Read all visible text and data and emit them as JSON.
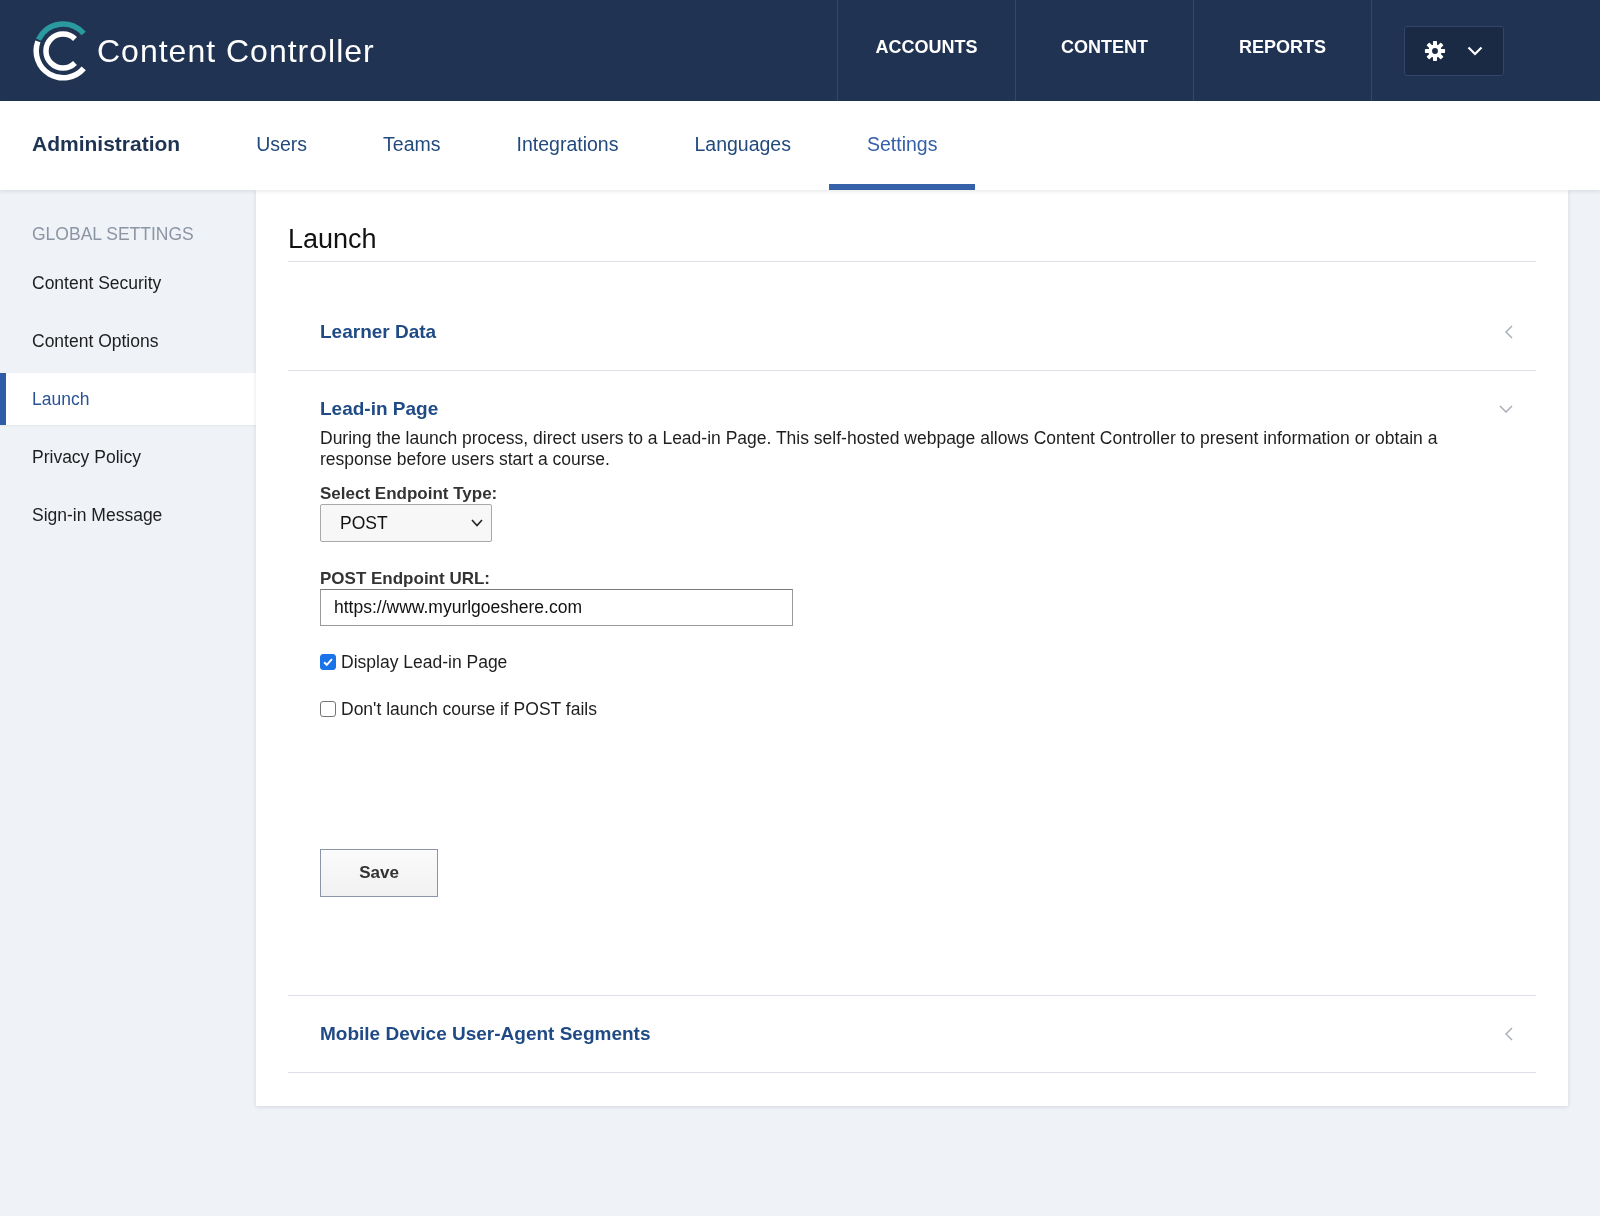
{
  "header": {
    "logo_text": "Content Controller",
    "nav": [
      {
        "label": "ACCOUNTS"
      },
      {
        "label": "CONTENT"
      },
      {
        "label": "REPORTS"
      }
    ]
  },
  "subnav": {
    "title": "Administration",
    "tabs": [
      {
        "label": "Users",
        "selected": false
      },
      {
        "label": "Teams",
        "selected": false
      },
      {
        "label": "Integrations",
        "selected": false
      },
      {
        "label": "Languages",
        "selected": false
      },
      {
        "label": "Settings",
        "selected": true
      }
    ]
  },
  "sidebar": {
    "heading": "GLOBAL SETTINGS",
    "items": [
      {
        "label": "Content Security",
        "selected": false
      },
      {
        "label": "Content Options",
        "selected": false
      },
      {
        "label": "Launch",
        "selected": true
      },
      {
        "label": "Privacy Policy",
        "selected": false
      },
      {
        "label": "Sign-in Message",
        "selected": false
      }
    ]
  },
  "page": {
    "title": "Launch",
    "sections": [
      {
        "title": "Learner Data",
        "expanded": false
      },
      {
        "title": "Lead-in Page",
        "expanded": true,
        "description": "During the launch process, direct users to a Lead-in Page. This self-hosted webpage allows Content Controller to present information or obtain a response before users start a course.",
        "fields": [
          {
            "kind": "select",
            "label": "Select Endpoint Type:",
            "value": "POST"
          },
          {
            "kind": "text",
            "label": "POST Endpoint URL:",
            "value": "https://www.myurlgoeshere.com"
          }
        ],
        "checkboxes": [
          {
            "label": "Display Lead-in Page",
            "checked": true
          },
          {
            "label": "Don't launch course if POST fails",
            "checked": false
          }
        ],
        "buttons": [
          "Save"
        ]
      },
      {
        "title": "Mobile Device User-Agent Segments",
        "expanded": false
      }
    ]
  }
}
